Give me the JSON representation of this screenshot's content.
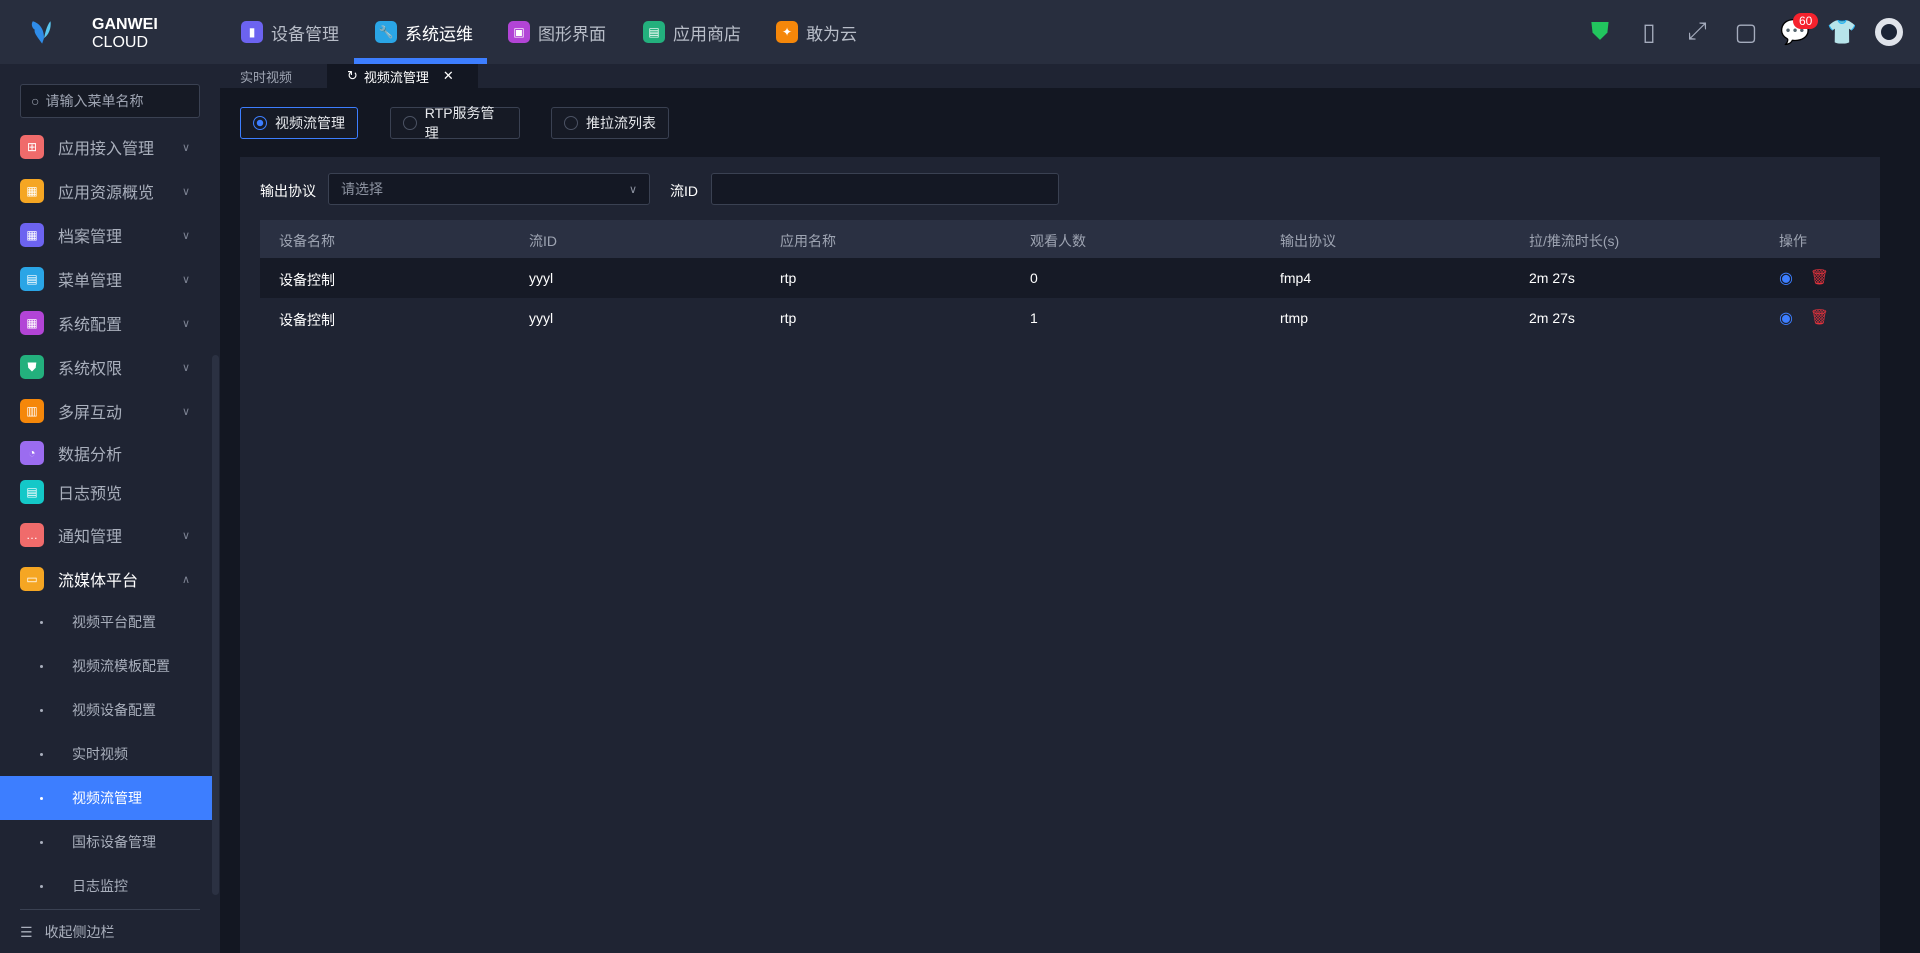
{
  "brand": {
    "line1": "GANWEI",
    "line2": "CLOUD"
  },
  "top_nav": [
    {
      "label": "设备管理",
      "color": "#6c63f0",
      "icon": "device-icon"
    },
    {
      "label": "系统运维",
      "color": "#2aa5e6",
      "icon": "wrench-icon"
    },
    {
      "label": "图形界面",
      "color": "#b244d6",
      "icon": "graphic-icon"
    },
    {
      "label": "应用商店",
      "color": "#23b07d",
      "icon": "store-icon"
    },
    {
      "label": "敢为云",
      "color": "#f5870a",
      "icon": "cloud-icon"
    }
  ],
  "notification_count": "60",
  "sidebar": {
    "search_placeholder": "请输入菜单名称",
    "items": [
      {
        "label": "应用接入管理",
        "color": "#f06b6b"
      },
      {
        "label": "应用资源概览",
        "color": "#f5a623"
      },
      {
        "label": "档案管理",
        "color": "#6c63f0"
      },
      {
        "label": "菜单管理",
        "color": "#2aa5e6"
      },
      {
        "label": "系统配置",
        "color": "#b244d6"
      },
      {
        "label": "系统权限",
        "color": "#23b07d"
      },
      {
        "label": "多屏互动",
        "color": "#f5870a"
      },
      {
        "label": "数据分析",
        "color": "#9b6cf0"
      },
      {
        "label": "日志预览",
        "color": "#14c8c8"
      },
      {
        "label": "通知管理",
        "color": "#f06b6b"
      },
      {
        "label": "流媒体平台",
        "color": "#f5a623"
      }
    ],
    "sub_items": [
      "视频平台配置",
      "视频流模板配置",
      "视频设备配置",
      "实时视频",
      "视频流管理",
      "国标设备管理",
      "日志监控"
    ],
    "collapse_label": "收起侧边栏"
  },
  "tabs": [
    "实时视频",
    "视频流管理"
  ],
  "radios": [
    "视频流管理",
    "RTP服务管理",
    "推拉流列表"
  ],
  "filters": {
    "protocol_label": "输出协议",
    "protocol_placeholder": "请选择",
    "stream_label": "流ID",
    "stream_value": ""
  },
  "table": {
    "headers": [
      "设备名称",
      "流ID",
      "应用名称",
      "观看人数",
      "输出协议",
      "拉/推流时长(s)",
      "操作"
    ],
    "rows": [
      [
        "设备控制",
        "yyyl",
        "rtp",
        "0",
        "fmp4",
        "2m 27s"
      ],
      [
        "设备控制",
        "yyyl",
        "rtp",
        "1",
        "rtmp",
        "2m 27s"
      ]
    ]
  }
}
